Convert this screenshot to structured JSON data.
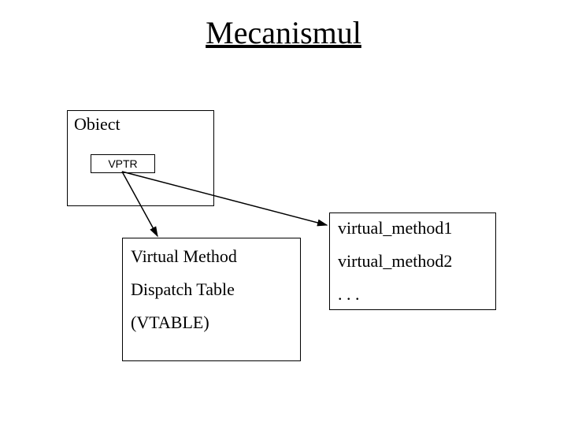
{
  "title": "Mecanismul",
  "object": {
    "label": "Obiect",
    "vptr": "VPTR"
  },
  "vtable": {
    "line1": "Virtual Method",
    "line2": "Dispatch Table",
    "line3": "(VTABLE)"
  },
  "methods": {
    "m1": "virtual_method1",
    "m2": "virtual_method2",
    "ellipsis": ". . ."
  }
}
